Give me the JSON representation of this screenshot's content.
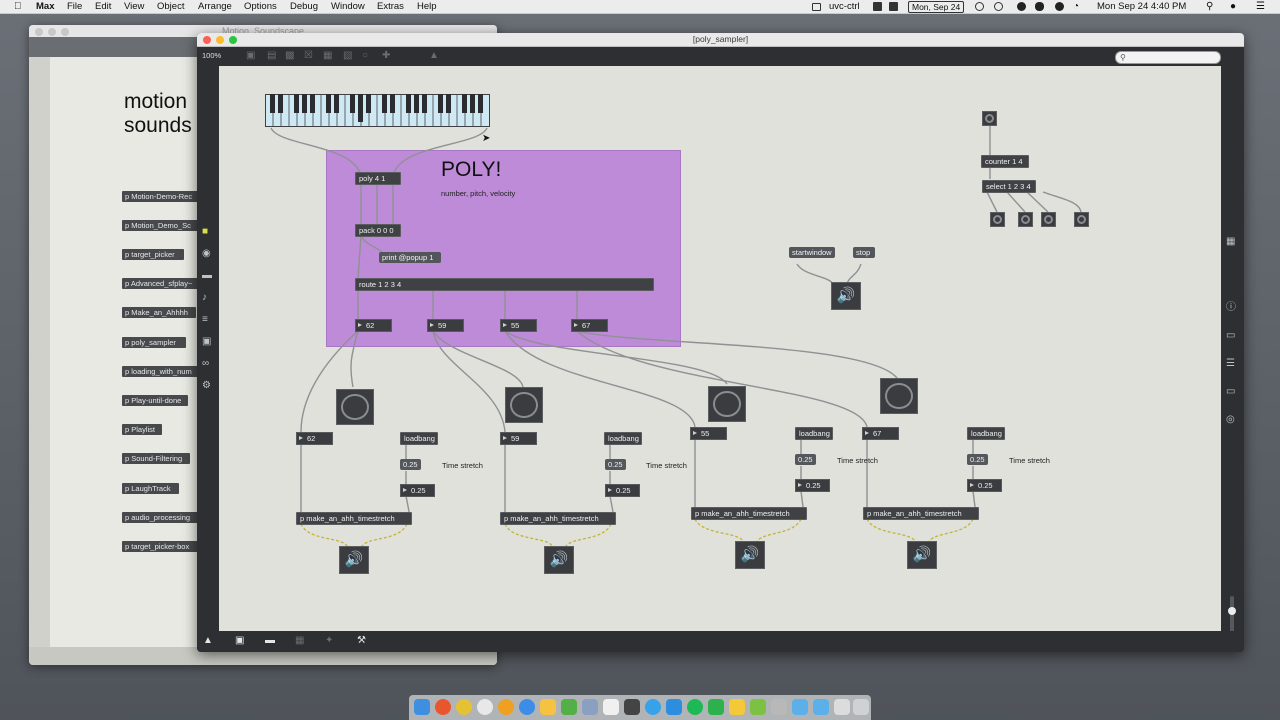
{
  "menubar": {
    "app": "Max",
    "items": [
      "File",
      "Edit",
      "View",
      "Object",
      "Arrange",
      "Options",
      "Debug",
      "Window",
      "Extras",
      "Help"
    ],
    "status_user": "uvc-ctrl",
    "status_date_badge": "Mon, Sep 24",
    "clock": "Mon Sep 24  4:40 PM"
  },
  "back_window": {
    "title": "Motion_Soundscape",
    "heading_line1": "motion",
    "heading_line2": "sounds",
    "subpatchers": [
      "p Motion-Demo-Rec",
      "p Motion_Demo_Sc",
      "p target_picker",
      "p Advanced_sfplay~",
      "p Make_an_Ahhhh",
      "p poly_sampler",
      "p loading_with_num",
      "p Play-until-done",
      "p Playlist",
      "p Sound-Filtering",
      "p LaughTrack",
      "p audio_processing",
      "p target_picker-box"
    ]
  },
  "main_window": {
    "title": "[poly_sampler]",
    "zoom": "100%",
    "search_placeholder": "",
    "panel_title": "POLY!",
    "panel_subtitle": "number, pitch, velocity",
    "objects": {
      "poly": "poly 4 1",
      "pack": "pack 0 0 0",
      "print": "print @popup 1",
      "route": "route 1 2 3 4",
      "counter": "counter 1 4",
      "select": "select 1 2 3 4",
      "startwindow": "startwindow",
      "stop": "stop"
    },
    "route_outputs": [
      "62",
      "59",
      "55",
      "67"
    ],
    "voices": [
      {
        "note": "62",
        "loadbang": "loadbang",
        "float1": "0.25",
        "float2": "0.25",
        "comment": "Time stretch",
        "subpatch": "p make_an_ahh_timestretch"
      },
      {
        "note": "59",
        "loadbang": "loadbang",
        "float1": "0.25",
        "float2": "0.25",
        "comment": "Time stretch",
        "subpatch": "p make_an_ahh_timestretch"
      },
      {
        "note": "55",
        "loadbang": "loadbang",
        "float1": "0.25",
        "float2": "0.25",
        "comment": "Time stretch",
        "subpatch": "p make_an_ahh_timestretch"
      },
      {
        "note": "67",
        "loadbang": "loadbang",
        "float1": "0.25",
        "float2": "0.25",
        "comment": "Time stretch",
        "subpatch": "p make_an_ahh_timestretch"
      }
    ],
    "colors": {
      "panel": "#be8bd9",
      "canvas": "#e0e1da",
      "object": "#3f4145",
      "accent_power": "#e0573a"
    }
  },
  "icons": {
    "dac": "speaker-icon",
    "bang": "bang-circle-icon",
    "lock": "lock-icon",
    "power": "power-icon"
  }
}
